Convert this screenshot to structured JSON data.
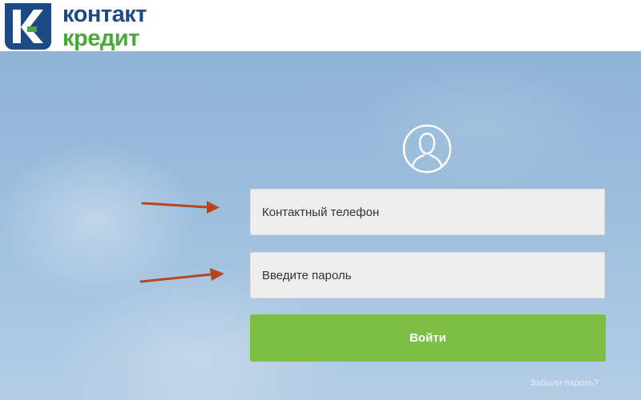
{
  "brand": {
    "name_line1": "контакт",
    "name_line2": "кредит",
    "primary_color": "#1b4a86",
    "secondary_color": "#48a83a"
  },
  "login_form": {
    "phone_placeholder": "Контактный телефон",
    "password_placeholder": "Введите пароль",
    "submit_label": "Войти",
    "forgot_link": "Забыли пароль?",
    "submit_color": "#7cbf42"
  },
  "icons": {
    "avatar": "user-avatar-icon",
    "annotation": "arrow-icon"
  }
}
